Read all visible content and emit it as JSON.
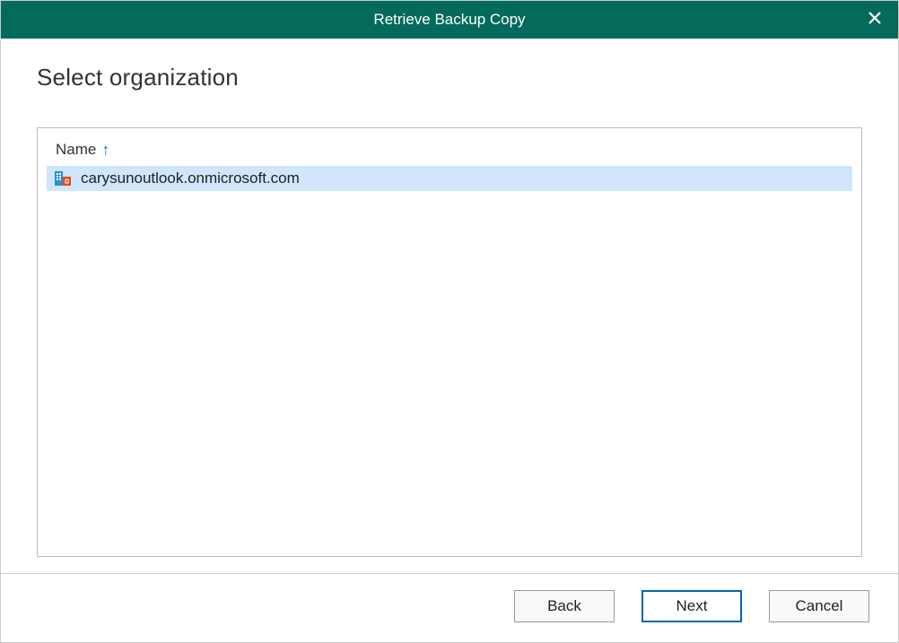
{
  "window": {
    "title": "Retrieve Backup Copy"
  },
  "page": {
    "heading": "Select organization"
  },
  "list": {
    "column_header": "Name",
    "items": [
      {
        "name": "carysunoutlook.onmicrosoft.com",
        "selected": true
      }
    ]
  },
  "buttons": {
    "back": "Back",
    "next": "Next",
    "cancel": "Cancel"
  }
}
